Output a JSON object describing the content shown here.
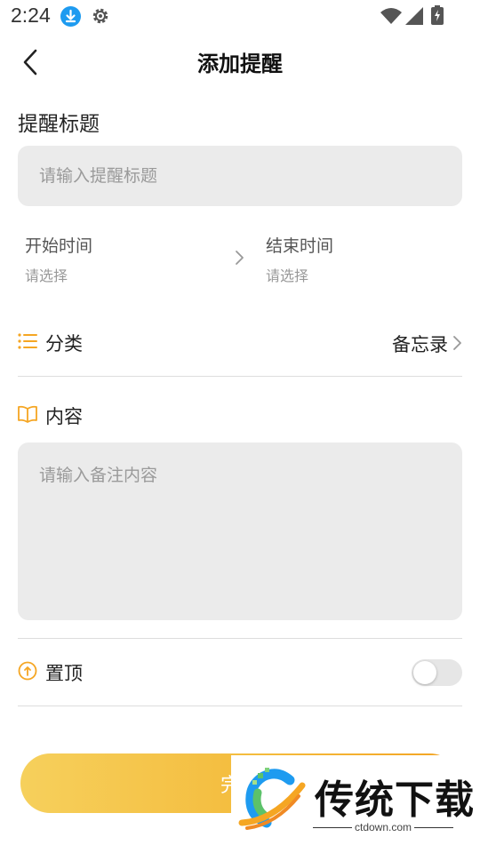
{
  "status_bar": {
    "time": "2:24",
    "icons": [
      "download-icon",
      "gear-icon",
      "wifi-icon",
      "signal-icon",
      "battery-icon"
    ]
  },
  "header": {
    "title": "添加提醒",
    "back_icon": "chevron-left-icon"
  },
  "form": {
    "title_section": {
      "label": "提醒标题",
      "placeholder": "请输入提醒标题",
      "value": ""
    },
    "start_time": {
      "label": "开始时间",
      "value": "请选择"
    },
    "end_time": {
      "label": "结束时间",
      "value": "请选择"
    },
    "category": {
      "label": "分类",
      "value": "备忘录",
      "icon": "list-icon"
    },
    "content": {
      "label": "内容",
      "placeholder": "请输入备注内容",
      "value": "",
      "icon": "book-icon"
    },
    "pin_top": {
      "label": "置顶",
      "enabled": false,
      "icon": "arrow-up-circle-icon"
    }
  },
  "footer": {
    "complete_button": "完成"
  },
  "watermark": {
    "text": "传统下载",
    "url": "ctdown.com"
  },
  "colors": {
    "accent": "#f5a623",
    "input_bg": "#ebebeb",
    "divider": "#dddddd",
    "button_gradient_start": "#f6d05c",
    "button_gradient_end": "#f3a321",
    "status_download": "#1e9bf0"
  }
}
